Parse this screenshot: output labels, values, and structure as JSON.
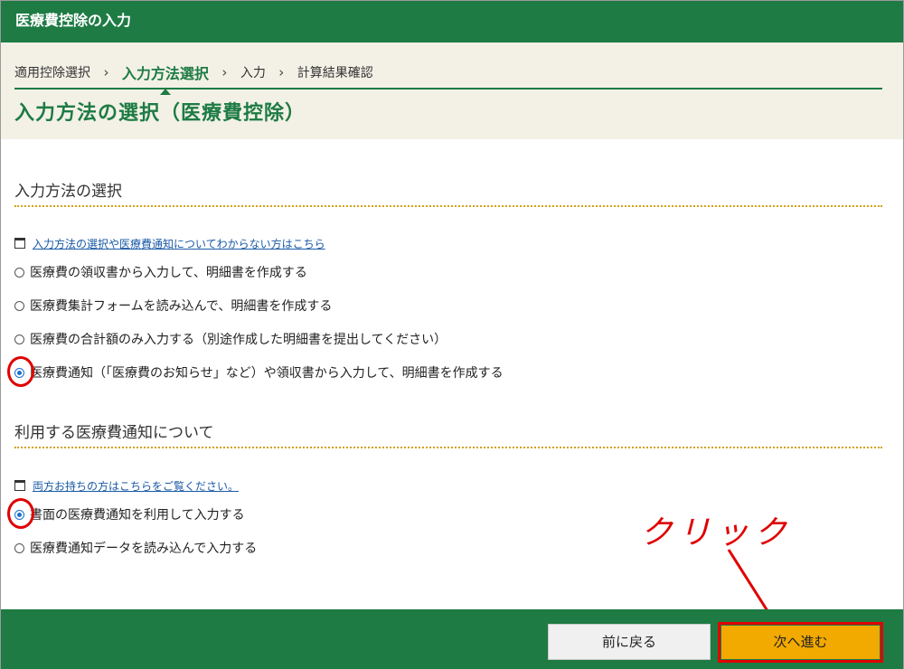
{
  "window": {
    "title": "医療費控除の入力"
  },
  "steps": [
    "適用控除選択",
    "入力方法選択",
    "入力",
    "計算結果確認"
  ],
  "step_separator": "›",
  "current_step_index": 1,
  "page_title": "入力方法の選択（医療費控除）",
  "section1": {
    "title": "入力方法の選択",
    "help_link": "入力方法の選択や医療費通知についてわからない方はこちら",
    "options": [
      {
        "label": "医療費の領収書から入力して、明細書を作成する",
        "checked": false
      },
      {
        "label": "医療費集計フォームを読み込んで、明細書を作成する",
        "checked": false
      },
      {
        "label": "医療費の合計額のみ入力する（別途作成した明細書を提出してください）",
        "checked": false
      },
      {
        "label": "医療費通知（「医療費のお知らせ」など）や領収書から入力して、明細書を作成する",
        "checked": true
      }
    ]
  },
  "section2": {
    "title": "利用する医療費通知について",
    "help_link": "両方お持ちの方はこちらをご覧ください。",
    "options": [
      {
        "label": "書面の医療費通知を利用して入力する",
        "checked": true
      },
      {
        "label": "医療費通知データを読み込んで入力する",
        "checked": false
      }
    ]
  },
  "buttons": {
    "back": "前に戻る",
    "next": "次へ進む"
  },
  "annotation": {
    "text": "クリック",
    "color": "#e00000"
  },
  "colors": {
    "brand_green": "#1e7b44",
    "next_button": "#f2a900",
    "header_bg": "#f3f1e6"
  }
}
